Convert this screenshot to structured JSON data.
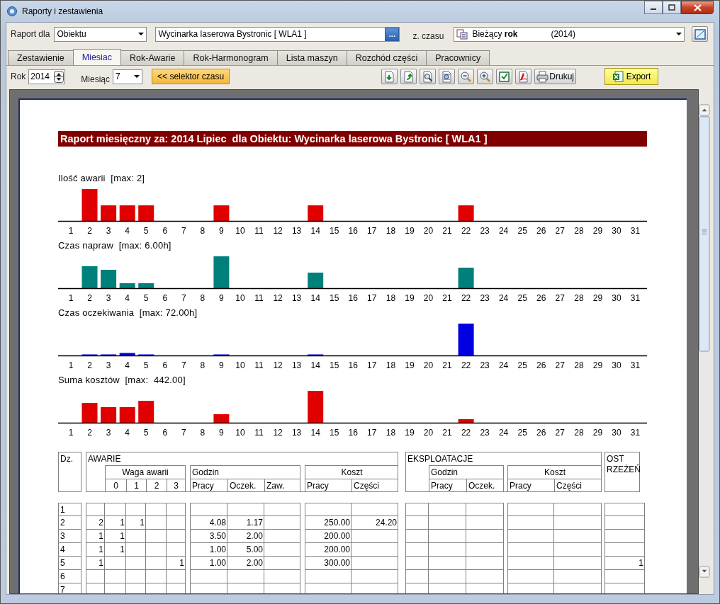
{
  "window": {
    "title": "Raporty i zestawienia"
  },
  "filters": {
    "report_for_label": "Raport dla",
    "report_for": "Obiektu",
    "object": "Wycinarka laserowa Bystronic [ WLA1 ]",
    "browse_button": "...",
    "time_label": "z. czasu",
    "time_range": "Bieżący **rok**",
    "time_year": "(2014)"
  },
  "tabs": [
    {
      "label": "Zestawienie",
      "selected": false
    },
    {
      "label": "Miesiac",
      "selected": true
    },
    {
      "label": "Rok-Awarie",
      "selected": false
    },
    {
      "label": "Rok-Harmonogram",
      "selected": false
    },
    {
      "label": "Lista maszyn",
      "selected": false
    },
    {
      "label": "Rozchód części",
      "selected": false
    },
    {
      "label": "Pracownicy",
      "selected": false
    }
  ],
  "toolbar": {
    "year_label": "Rok",
    "year": "2014",
    "month_label": "Miesiąc",
    "month": "7",
    "time_selector_button": "<< selektor czasu",
    "print_button": "Drukuj",
    "export_button": "Export"
  },
  "report": {
    "title": "Raport miesięczny za: 2014 Lipiec  dla Obiektu: Wycinarka laserowa Bystronic [ WLA1 ]",
    "charts": [
      {
        "title": "Ilość awarii  [max: 2]",
        "day_labels": [
          "1",
          "2",
          "3",
          "4",
          "5",
          "6",
          "7",
          "8",
          "9",
          "10",
          "11",
          "12",
          "13",
          "14",
          "15",
          "16",
          "17",
          "18",
          "19",
          "20",
          "21",
          "22",
          "23",
          "24",
          "25",
          "26",
          "27",
          "28",
          "29",
          "30",
          "31"
        ]
      },
      {
        "title": "Czas napraw  [max: 6.00h]",
        "day_labels": [
          "1",
          "2",
          "3",
          "4",
          "5",
          "6",
          "7",
          "8",
          "9",
          "10",
          "11",
          "12",
          "13",
          "14",
          "15",
          "16",
          "17",
          "18",
          "19",
          "20",
          "21",
          "22",
          "23",
          "24",
          "25",
          "26",
          "27",
          "28",
          "29",
          "30",
          "31"
        ]
      },
      {
        "title": "Czas oczekiwania  [max: 72.00h]",
        "day_labels": [
          "1",
          "2",
          "3",
          "4",
          "5",
          "6",
          "7",
          "8",
          "9",
          "10",
          "11",
          "12",
          "13",
          "14",
          "15",
          "16",
          "17",
          "18",
          "19",
          "20",
          "21",
          "22",
          "23",
          "24",
          "25",
          "26",
          "27",
          "28",
          "29",
          "30",
          "31"
        ]
      },
      {
        "title": "Suma kosztów  [max:  442.00]",
        "day_labels": [
          "1",
          "2",
          "3",
          "4",
          "5",
          "6",
          "7",
          "8",
          "9",
          "10",
          "11",
          "12",
          "13",
          "14",
          "15",
          "16",
          "17",
          "18",
          "19",
          "20",
          "21",
          "22",
          "23",
          "24",
          "25",
          "26",
          "27",
          "28",
          "29",
          "30",
          "31"
        ]
      }
    ],
    "table": {
      "header": {
        "day": "Dz.",
        "failures": "AWARIE",
        "weight": "Waga awarii",
        "weights": [
          "0",
          "1",
          "2",
          "3"
        ],
        "hours": "Godzin",
        "hours_cols": [
          "Pracy",
          "Oczek.",
          "Zaw."
        ],
        "cost": "Koszt",
        "cost_cols": [
          "Pracy",
          "Części"
        ],
        "operations": "EKSPLOATACJE",
        "op_hours": "Godzin",
        "op_hours_cols": [
          "Pracy",
          "Oczek."
        ],
        "op_cost": "Koszt",
        "op_cost_cols": [
          "Pracy",
          "Części"
        ],
        "warnings": "OST RZEŻEŃ"
      },
      "rows": [
        {
          "cells": [
            "1",
            "",
            "",
            "",
            "",
            "",
            "",
            "",
            "",
            "",
            "",
            "",
            "",
            "",
            "",
            "",
            ""
          ]
        },
        {
          "cells": [
            "2",
            "2",
            "1",
            "1",
            "",
            "",
            "4.08",
            "1.17",
            "",
            "250.00",
            "24.20",
            "",
            "",
            "",
            "",
            "",
            ""
          ]
        },
        {
          "cells": [
            "3",
            "1",
            "1",
            "",
            "",
            "",
            "3.50",
            "2.00",
            "",
            "200.00",
            "",
            "",
            "",
            "",
            "",
            "",
            ""
          ]
        },
        {
          "cells": [
            "4",
            "1",
            "1",
            "",
            "",
            "",
            "1.00",
            "5.00",
            "",
            "200.00",
            "",
            "",
            "",
            "",
            "",
            "",
            ""
          ]
        },
        {
          "cells": [
            "5",
            "1",
            "",
            "",
            "",
            "1",
            "1.00",
            "2.00",
            "",
            "300.00",
            "",
            "",
            "",
            "",
            "",
            "",
            "1"
          ]
        },
        {
          "cells": [
            "6",
            "",
            "",
            "",
            "",
            "",
            "",
            "",
            "",
            "",
            "",
            "",
            "",
            "",
            "",
            "",
            ""
          ]
        },
        {
          "cells": [
            "7",
            "",
            "",
            "",
            "",
            "",
            "",
            "",
            "",
            "",
            "",
            "",
            "",
            "",
            "",
            "",
            ""
          ]
        }
      ]
    }
  }
}
